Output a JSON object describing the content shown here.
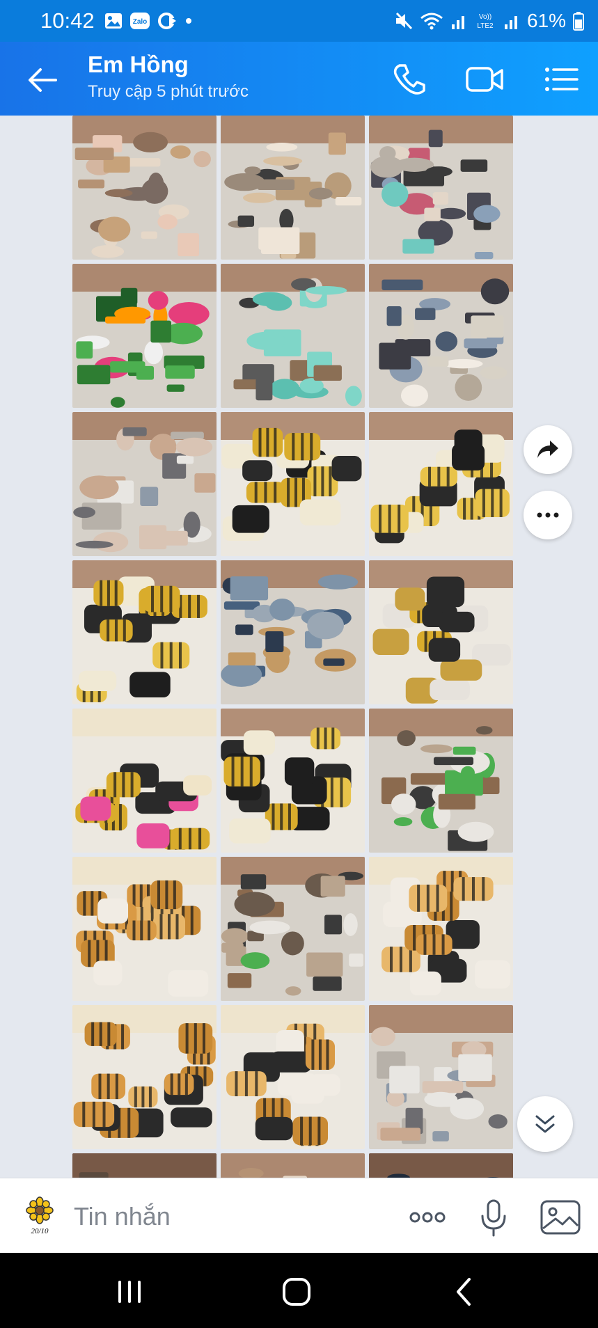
{
  "status": {
    "time": "10:42",
    "battery": "61%",
    "icons_left": [
      "gallery-icon",
      "zalo-icon",
      "refresh-icon",
      "dot-icon"
    ],
    "icons_right": [
      "mute-icon",
      "wifi-icon",
      "signal-icon",
      "volte-icon",
      "signal-icon",
      "battery-icon"
    ]
  },
  "header": {
    "title": "Em Hồng",
    "subtitle": "Truy cập 5 phút trước",
    "buttons": [
      "back-icon",
      "phone-icon",
      "video-call-icon",
      "menu-list-icon"
    ]
  },
  "gallery": {
    "rows": 8,
    "columns": 3,
    "tiles": [
      {
        "theme": "mixed-boxes"
      },
      {
        "theme": "cardboard-boxes"
      },
      {
        "theme": "clothes-teal"
      },
      {
        "theme": "green-bags"
      },
      {
        "theme": "teal-boxes"
      },
      {
        "theme": "clothes-child"
      },
      {
        "theme": "clothes-white"
      },
      {
        "theme": "yellow-bales"
      },
      {
        "theme": "yellow-bales"
      },
      {
        "theme": "yellow-bales"
      },
      {
        "theme": "clothes-denim"
      },
      {
        "theme": "yellow-bales-floor"
      },
      {
        "theme": "yellow-bales-pink"
      },
      {
        "theme": "yellow-bales"
      },
      {
        "theme": "clothes-floor"
      },
      {
        "theme": "orange-bales-child"
      },
      {
        "theme": "clothes-floor"
      },
      {
        "theme": "orange-bales-child"
      },
      {
        "theme": "orange-bales"
      },
      {
        "theme": "orange-bales-child"
      },
      {
        "theme": "clothes-white"
      },
      {
        "theme": "dark"
      },
      {
        "theme": "mixed-boxes"
      },
      {
        "theme": "dark"
      }
    ]
  },
  "fabs": [
    "share-forward-icon",
    "more-horizontal-icon",
    "scroll-down-icon"
  ],
  "input": {
    "placeholder": "Tin nhắn",
    "sticker_label": "20/10",
    "buttons": [
      "more-dots-icon",
      "microphone-icon",
      "image-icon"
    ]
  },
  "navbar": [
    "recent-apps-icon",
    "home-icon",
    "back-nav-icon"
  ],
  "colors": {
    "header_start": "#1873e8",
    "header_end": "#0fa0ff",
    "background": "#e4e8ef",
    "yellow_bale": "#d7a92a",
    "orange_bale": "#d99a45"
  }
}
